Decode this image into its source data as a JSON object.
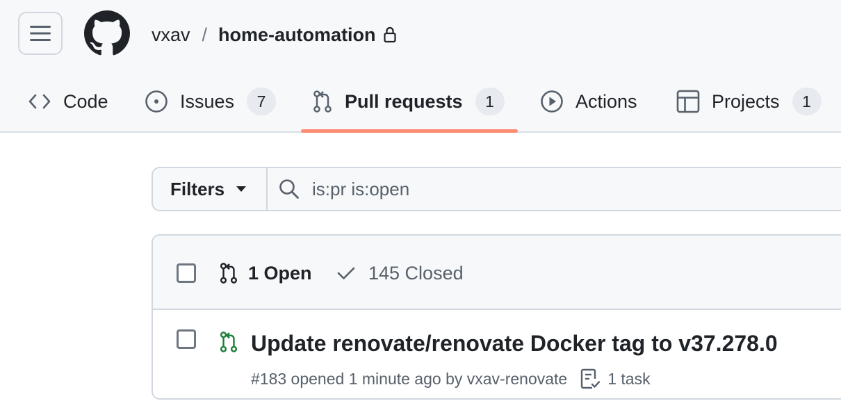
{
  "header": {
    "owner": "vxav",
    "separator": "/",
    "repo_name": "home-automation",
    "visibility_icon": "lock-icon"
  },
  "tabs": [
    {
      "label": "Code",
      "icon": "code-icon",
      "counter": null,
      "active": false
    },
    {
      "label": "Issues",
      "icon": "issue-opened-icon",
      "counter": "7",
      "active": false
    },
    {
      "label": "Pull requests",
      "icon": "git-pull-request-icon",
      "counter": "1",
      "active": true
    },
    {
      "label": "Actions",
      "icon": "play-icon",
      "counter": null,
      "active": false
    },
    {
      "label": "Projects",
      "icon": "table-icon",
      "counter": "1",
      "active": false
    }
  ],
  "filter": {
    "button_label": "Filters",
    "search_value": "is:pr is:open"
  },
  "list_header": {
    "open_label": "1 Open",
    "closed_label": "145 Closed"
  },
  "pull_requests": [
    {
      "title": "Update renovate/renovate Docker tag to v37.278.0",
      "meta": "#183 opened 1 minute ago by vxav-renovate",
      "tasks": "1 task",
      "state_color": "#1a7f37"
    }
  ],
  "colors": {
    "accent_underline": "#fd8c73",
    "open_green": "#1a7f37",
    "muted_text": "#57606a"
  }
}
